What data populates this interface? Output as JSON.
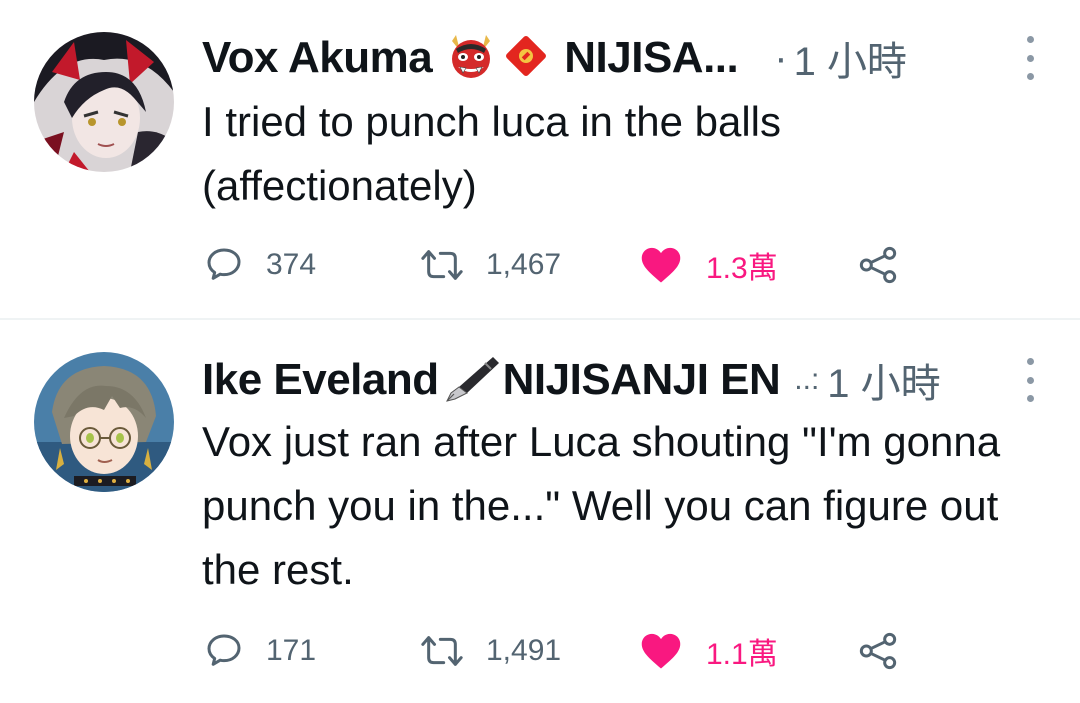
{
  "tweets": [
    {
      "author": "Vox Akuma",
      "author_suffix": "NIJISA...",
      "dot": "·",
      "time": "1 小時",
      "text": "I tried to punch luca in the balls (affectionately)",
      "replies": "374",
      "retweets": "1,467",
      "likes": "1.3萬",
      "emojis": [
        "ogre-mask-emoji",
        "red-envelope-emoji"
      ]
    },
    {
      "author": "Ike Eveland",
      "author_suffix": "NIJISANJI EN",
      "dot": "..:",
      "time": "1 小時",
      "text": "Vox just ran after Luca shouting \"I'm gonna punch you in the...\" Well you can figure out the rest.",
      "replies": "171",
      "retweets": "1,491",
      "likes": "1.1萬",
      "emojis": [
        "fountain-pen-emoji"
      ]
    }
  ],
  "colors": {
    "text": "#0f1419",
    "muted": "#536471",
    "like": "#f91880",
    "divider": "#eff3f4"
  }
}
